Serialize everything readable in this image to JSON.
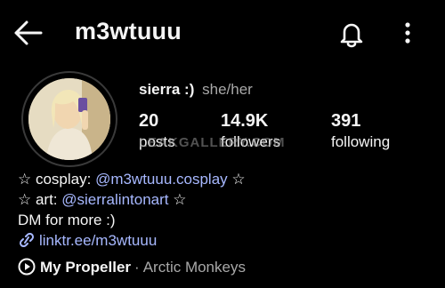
{
  "header": {
    "username": "m3wtuuu",
    "back_icon": "arrow-left-icon",
    "bell_icon": "bell-icon",
    "more_icon": "more-vertical-icon"
  },
  "profile": {
    "display_name": "sierra :)",
    "pronouns": "she/her",
    "stats": [
      {
        "value": "20",
        "label": "posts"
      },
      {
        "value": "14.9K",
        "label": "followers"
      },
      {
        "value": "391",
        "label": "following"
      }
    ],
    "watermark": "LEAKGALLERY.COM"
  },
  "bio": {
    "line1_prefix": "☆ cosplay: ",
    "line1_handle": "@m3wtuuu.cosplay",
    "line1_suffix": " ☆",
    "line2_prefix": "☆ art: ",
    "line2_handle": "@sierralintonart",
    "line2_suffix": " ☆",
    "line3": "DM for more :)",
    "link": "linktr.ee/m3wtuuu"
  },
  "music": {
    "song": "My Propeller",
    "separator": "·",
    "artist": "Arctic Monkeys"
  },
  "colors": {
    "background": "#000000",
    "text": "#f5f5f5",
    "secondary": "#a8a8a8",
    "link": "#a7b8ff"
  }
}
